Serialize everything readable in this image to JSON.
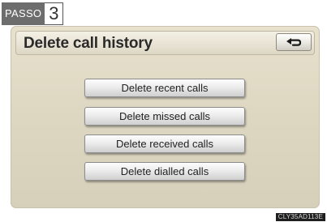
{
  "badge": {
    "model": "PASSO",
    "step": "3"
  },
  "header": {
    "title": "Delete call history",
    "back_icon": "return-arrow-icon"
  },
  "menu": {
    "items": [
      {
        "label": "Delete recent calls"
      },
      {
        "label": "Delete missed calls"
      },
      {
        "label": "Delete received calls"
      },
      {
        "label": "Delete dialled calls"
      }
    ]
  },
  "figure_code": "CLY35AD113E"
}
